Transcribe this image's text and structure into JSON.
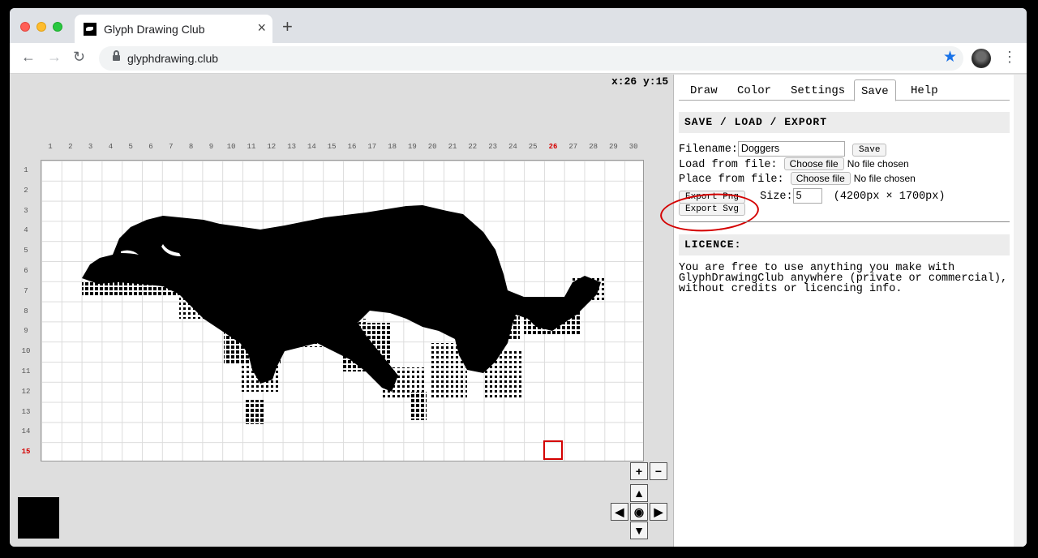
{
  "browser": {
    "tab_title": "Glyph Drawing Club",
    "url": "glyphdrawing.club",
    "new_tab_label": "+",
    "close_label": "×"
  },
  "canvas": {
    "coords": "x:26 y:15",
    "columns": [
      "1",
      "2",
      "3",
      "4",
      "5",
      "6",
      "7",
      "8",
      "9",
      "10",
      "11",
      "12",
      "13",
      "14",
      "15",
      "16",
      "17",
      "18",
      "19",
      "20",
      "21",
      "22",
      "23",
      "24",
      "25",
      "26",
      "27",
      "28",
      "29",
      "30"
    ],
    "rows": [
      "1",
      "2",
      "3",
      "4",
      "5",
      "6",
      "7",
      "8",
      "9",
      "10",
      "11",
      "12",
      "13",
      "14",
      "15"
    ],
    "highlight_column": "26",
    "highlight_row": "15"
  },
  "controls": {
    "zoom_in": "+",
    "zoom_out": "−",
    "up": "▲",
    "left": "◀",
    "center": "◉",
    "right": "▶",
    "down": "▼"
  },
  "panel": {
    "tabs": [
      "Draw",
      "Color",
      "Settings",
      "Save",
      "Help"
    ],
    "active_tab": "Save",
    "section_title": "SAVE / LOAD / EXPORT",
    "filename_label": "Filename:",
    "filename_value": "Doggers",
    "save_button": "Save",
    "load_label": "Load from file:",
    "place_label": "Place from file:",
    "choose_file": "Choose file",
    "no_file": "No file chosen",
    "export_png": "Export Png",
    "size_label": "Size:",
    "size_value": "5",
    "size_info": "(4200px × 1700px)",
    "export_svg": "Export Svg",
    "licence_title": "LICENCE:",
    "licence_text": "You are free to use anything you make with\nGlyphDrawingClub anywhere (private or commercial),\nwithout credits or licencing info."
  },
  "colors": {
    "highlight": "#d40000",
    "star": "#1a73e8"
  }
}
